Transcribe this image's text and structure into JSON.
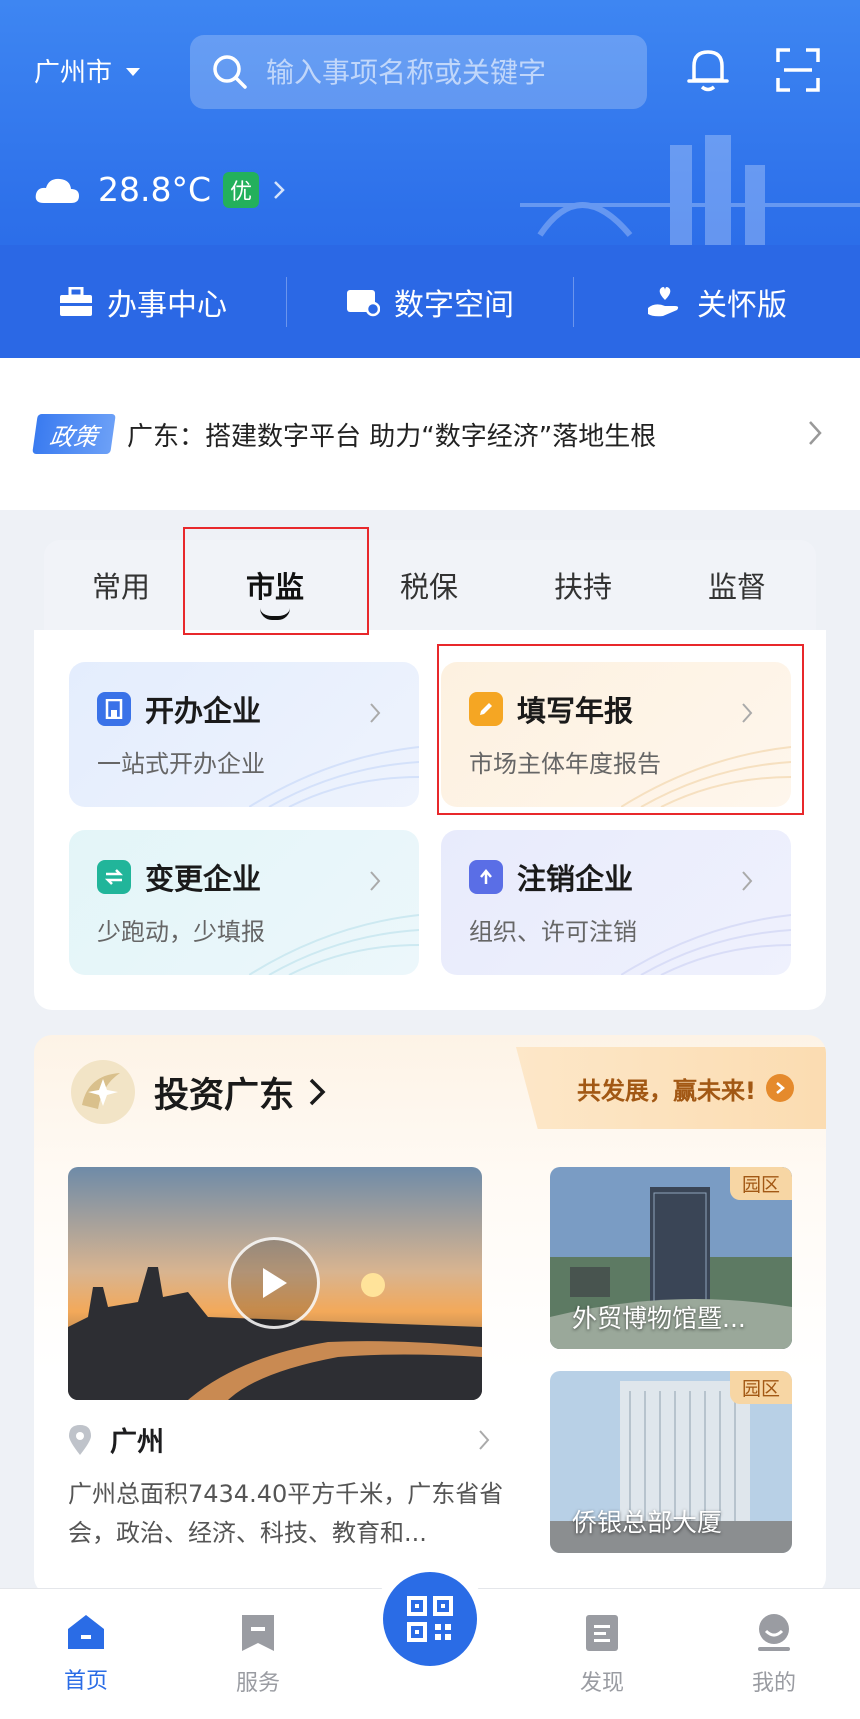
{
  "header": {
    "city": "广州市",
    "search_placeholder": "输入事项名称或关键字",
    "temperature": "28.8°C",
    "aqi": "优"
  },
  "quick_links": [
    {
      "label": "办事中心",
      "icon": "briefcase-icon"
    },
    {
      "label": "数字空间",
      "icon": "digital-space-icon"
    },
    {
      "label": "关怀版",
      "icon": "care-hand-icon"
    }
  ],
  "news": {
    "tag": "政策",
    "text": "广东：搭建数字平台 助力“数字经济”落地生根"
  },
  "tabs": [
    "常用",
    "市监",
    "税保",
    "扶持",
    "监督"
  ],
  "active_tab": "市监",
  "services": [
    {
      "title": "开办企业",
      "subtitle": "一站式开办企业",
      "icon": "building-icon",
      "color": "#3a72e8"
    },
    {
      "title": "填写年报",
      "subtitle": "市场主体年度报告",
      "icon": "pencil-icon",
      "color": "#f5a623"
    },
    {
      "title": "变更企业",
      "subtitle": "少跑动，少填报",
      "icon": "swap-icon",
      "color": "#21b59a"
    },
    {
      "title": "注销企业",
      "subtitle": "组织、许可注销",
      "icon": "arrow-up-icon",
      "color": "#5a6ee6"
    }
  ],
  "invest": {
    "title": "投资广东",
    "slogan": "共发展，赢未来!",
    "location": "广州",
    "description": "广州总面积7434.40平方千米，广东省省会，政治、经济、科技、教育和...",
    "parks": [
      {
        "tag": "园区",
        "name": "外贸博物馆暨..."
      },
      {
        "tag": "园区",
        "name": "侨银总部大厦"
      }
    ]
  },
  "bottom_nav": [
    {
      "label": "首页",
      "active": true
    },
    {
      "label": "服务"
    },
    {
      "label": "发现"
    },
    {
      "label": "我的"
    }
  ],
  "colors": {
    "primary": "#2a6ce6",
    "highlight_box": "#e8282b",
    "aqi_good": "#23b05c"
  }
}
